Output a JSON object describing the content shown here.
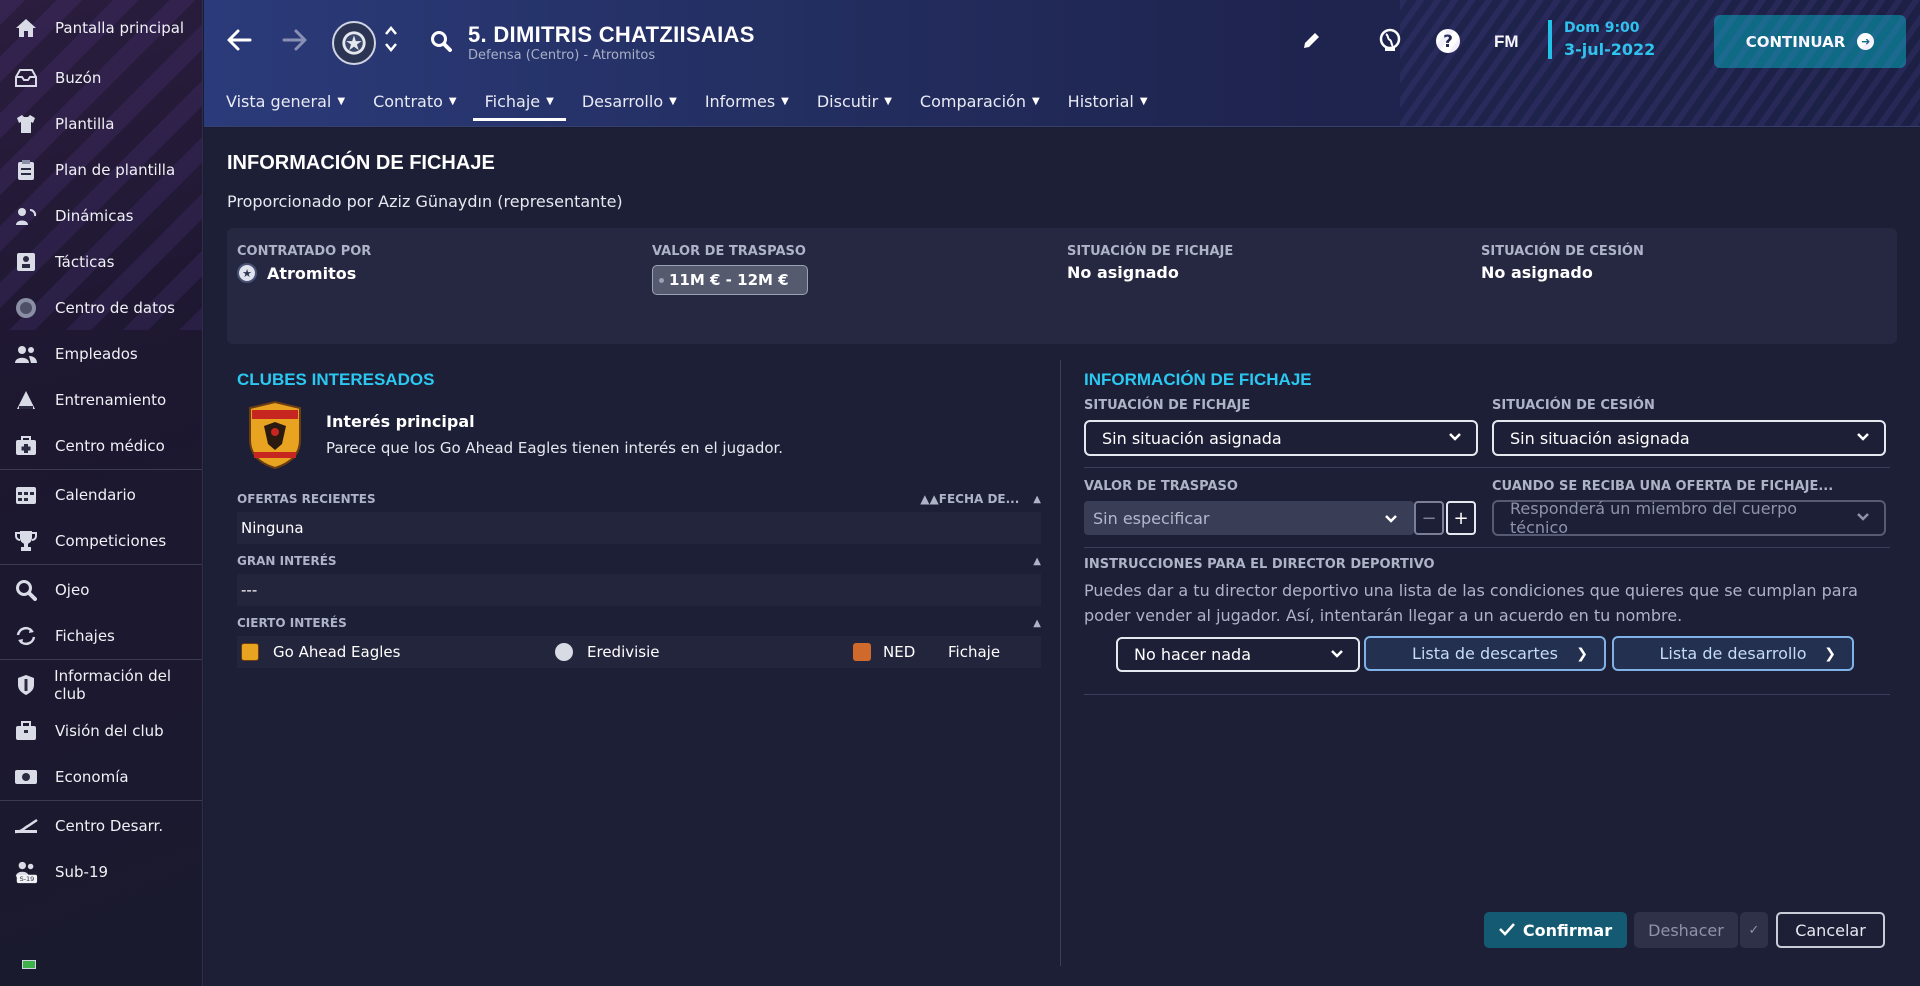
{
  "sidebar": {
    "groups": [
      [
        {
          "label": "Pantalla principal",
          "icon": "home-icon"
        },
        {
          "label": "Buzón",
          "icon": "inbox-icon"
        },
        {
          "label": "Plantilla",
          "icon": "shirt-icon"
        },
        {
          "label": "Plan de plantilla",
          "icon": "clipboard-icon"
        },
        {
          "label": "Dinámicas",
          "icon": "dynamics-icon"
        },
        {
          "label": "Tácticas",
          "icon": "tactics-icon"
        },
        {
          "label": "Centro de datos",
          "icon": "data-icon"
        },
        {
          "label": "Empleados",
          "icon": "staff-icon"
        },
        {
          "label": "Entrenamiento",
          "icon": "training-icon"
        },
        {
          "label": "Centro médico",
          "icon": "medical-icon"
        }
      ],
      [
        {
          "label": "Calendario",
          "icon": "calendar-icon"
        },
        {
          "label": "Competiciones",
          "icon": "trophy-icon"
        }
      ],
      [
        {
          "label": "Ojeo",
          "icon": "scout-icon"
        },
        {
          "label": "Fichajes",
          "icon": "transfers-icon"
        }
      ],
      [
        {
          "label": "Información del club",
          "icon": "club-shield-icon"
        },
        {
          "label": "Visión del club",
          "icon": "briefcase-icon"
        },
        {
          "label": "Economía",
          "icon": "money-icon"
        }
      ],
      [
        {
          "label": "Centro Desarr.",
          "icon": "development-icon"
        },
        {
          "label": "Sub-19",
          "icon": "u19-icon"
        }
      ]
    ]
  },
  "header": {
    "player_name": "5. DIMITRIS CHATZIISAIAS",
    "player_sub": "Defensa (Centro) - Atromitos",
    "fm_label": "FM",
    "date_time": "Dom 9:00",
    "date": "3-jul-2022",
    "continue_label": "CONTINUAR",
    "tabs": [
      "Vista general",
      "Contrato",
      "Fichaje",
      "Desarrollo",
      "Informes",
      "Discutir",
      "Comparación",
      "Historial"
    ],
    "active_tab": "Fichaje"
  },
  "main": {
    "title": "INFORMACIÓN DE FICHAJE",
    "provided_by": "Proporcionado por Aziz Günaydın (representante)",
    "summary": {
      "contracted_label": "CONTRATADO POR",
      "contracted_value": "Atromitos",
      "value_label": "VALOR DE TRASPASO",
      "value_value": "11M € - 12M €",
      "status_label": "SITUACIÓN DE FICHAJE",
      "status_value": "No asignado",
      "loan_label": "SITUACIÓN DE CESIÓN",
      "loan_value": "No asignado"
    },
    "left": {
      "title": "CLUBES INTERESADOS",
      "main_interest_title": "Interés principal",
      "main_interest_desc": "Parece que los Go Ahead Eagles tienen interés en el jugador.",
      "recent_offers_label": "OFERTAS RECIENTES",
      "date_col_label": "FECHA DE...",
      "recent_offers_value": "Ninguna",
      "strong_interest_label": "GRAN INTERÉS",
      "strong_interest_value": "---",
      "some_interest_label": "CIERTO INTERÉS",
      "some_interest_row": {
        "club": "Go Ahead Eagles",
        "league": "Eredivisie",
        "nation": "NED",
        "type": "Fichaje"
      }
    },
    "right": {
      "title": "INFORMACIÓN DE FICHAJE",
      "status_label": "SITUACIÓN DE FICHAJE",
      "status_value": "Sin situación asignada",
      "loan_label": "SITUACIÓN DE CESIÓN",
      "loan_value": "Sin situación asignada",
      "value_label": "VALOR DE TRASPASO",
      "value_placeholder": "Sin especificar",
      "offer_label": "CUANDO SE RECIBA UNA OFERTA DE FICHAJE...",
      "offer_value": "Responderá un miembro del cuerpo técnico",
      "instructions_label": "INSTRUCCIONES PARA EL DIRECTOR DEPORTIVO",
      "instructions_text": "Puedes dar a tu director deportivo una lista de las condiciones que quieres que se cumplan para poder vender al jugador. Así, intentarán llegar a un acuerdo en tu nombre.",
      "action_value": "No hacer nada",
      "list_discard": "Lista de descartes",
      "list_development": "Lista de desarrollo"
    },
    "footer": {
      "confirm": "Confirmar",
      "undo": "Deshacer",
      "cancel": "Cancelar"
    }
  },
  "colors": {
    "accent_cyan": "#2bc8f2",
    "continue_bg": "#0f6a85",
    "confirm_bg": "#155a73"
  }
}
